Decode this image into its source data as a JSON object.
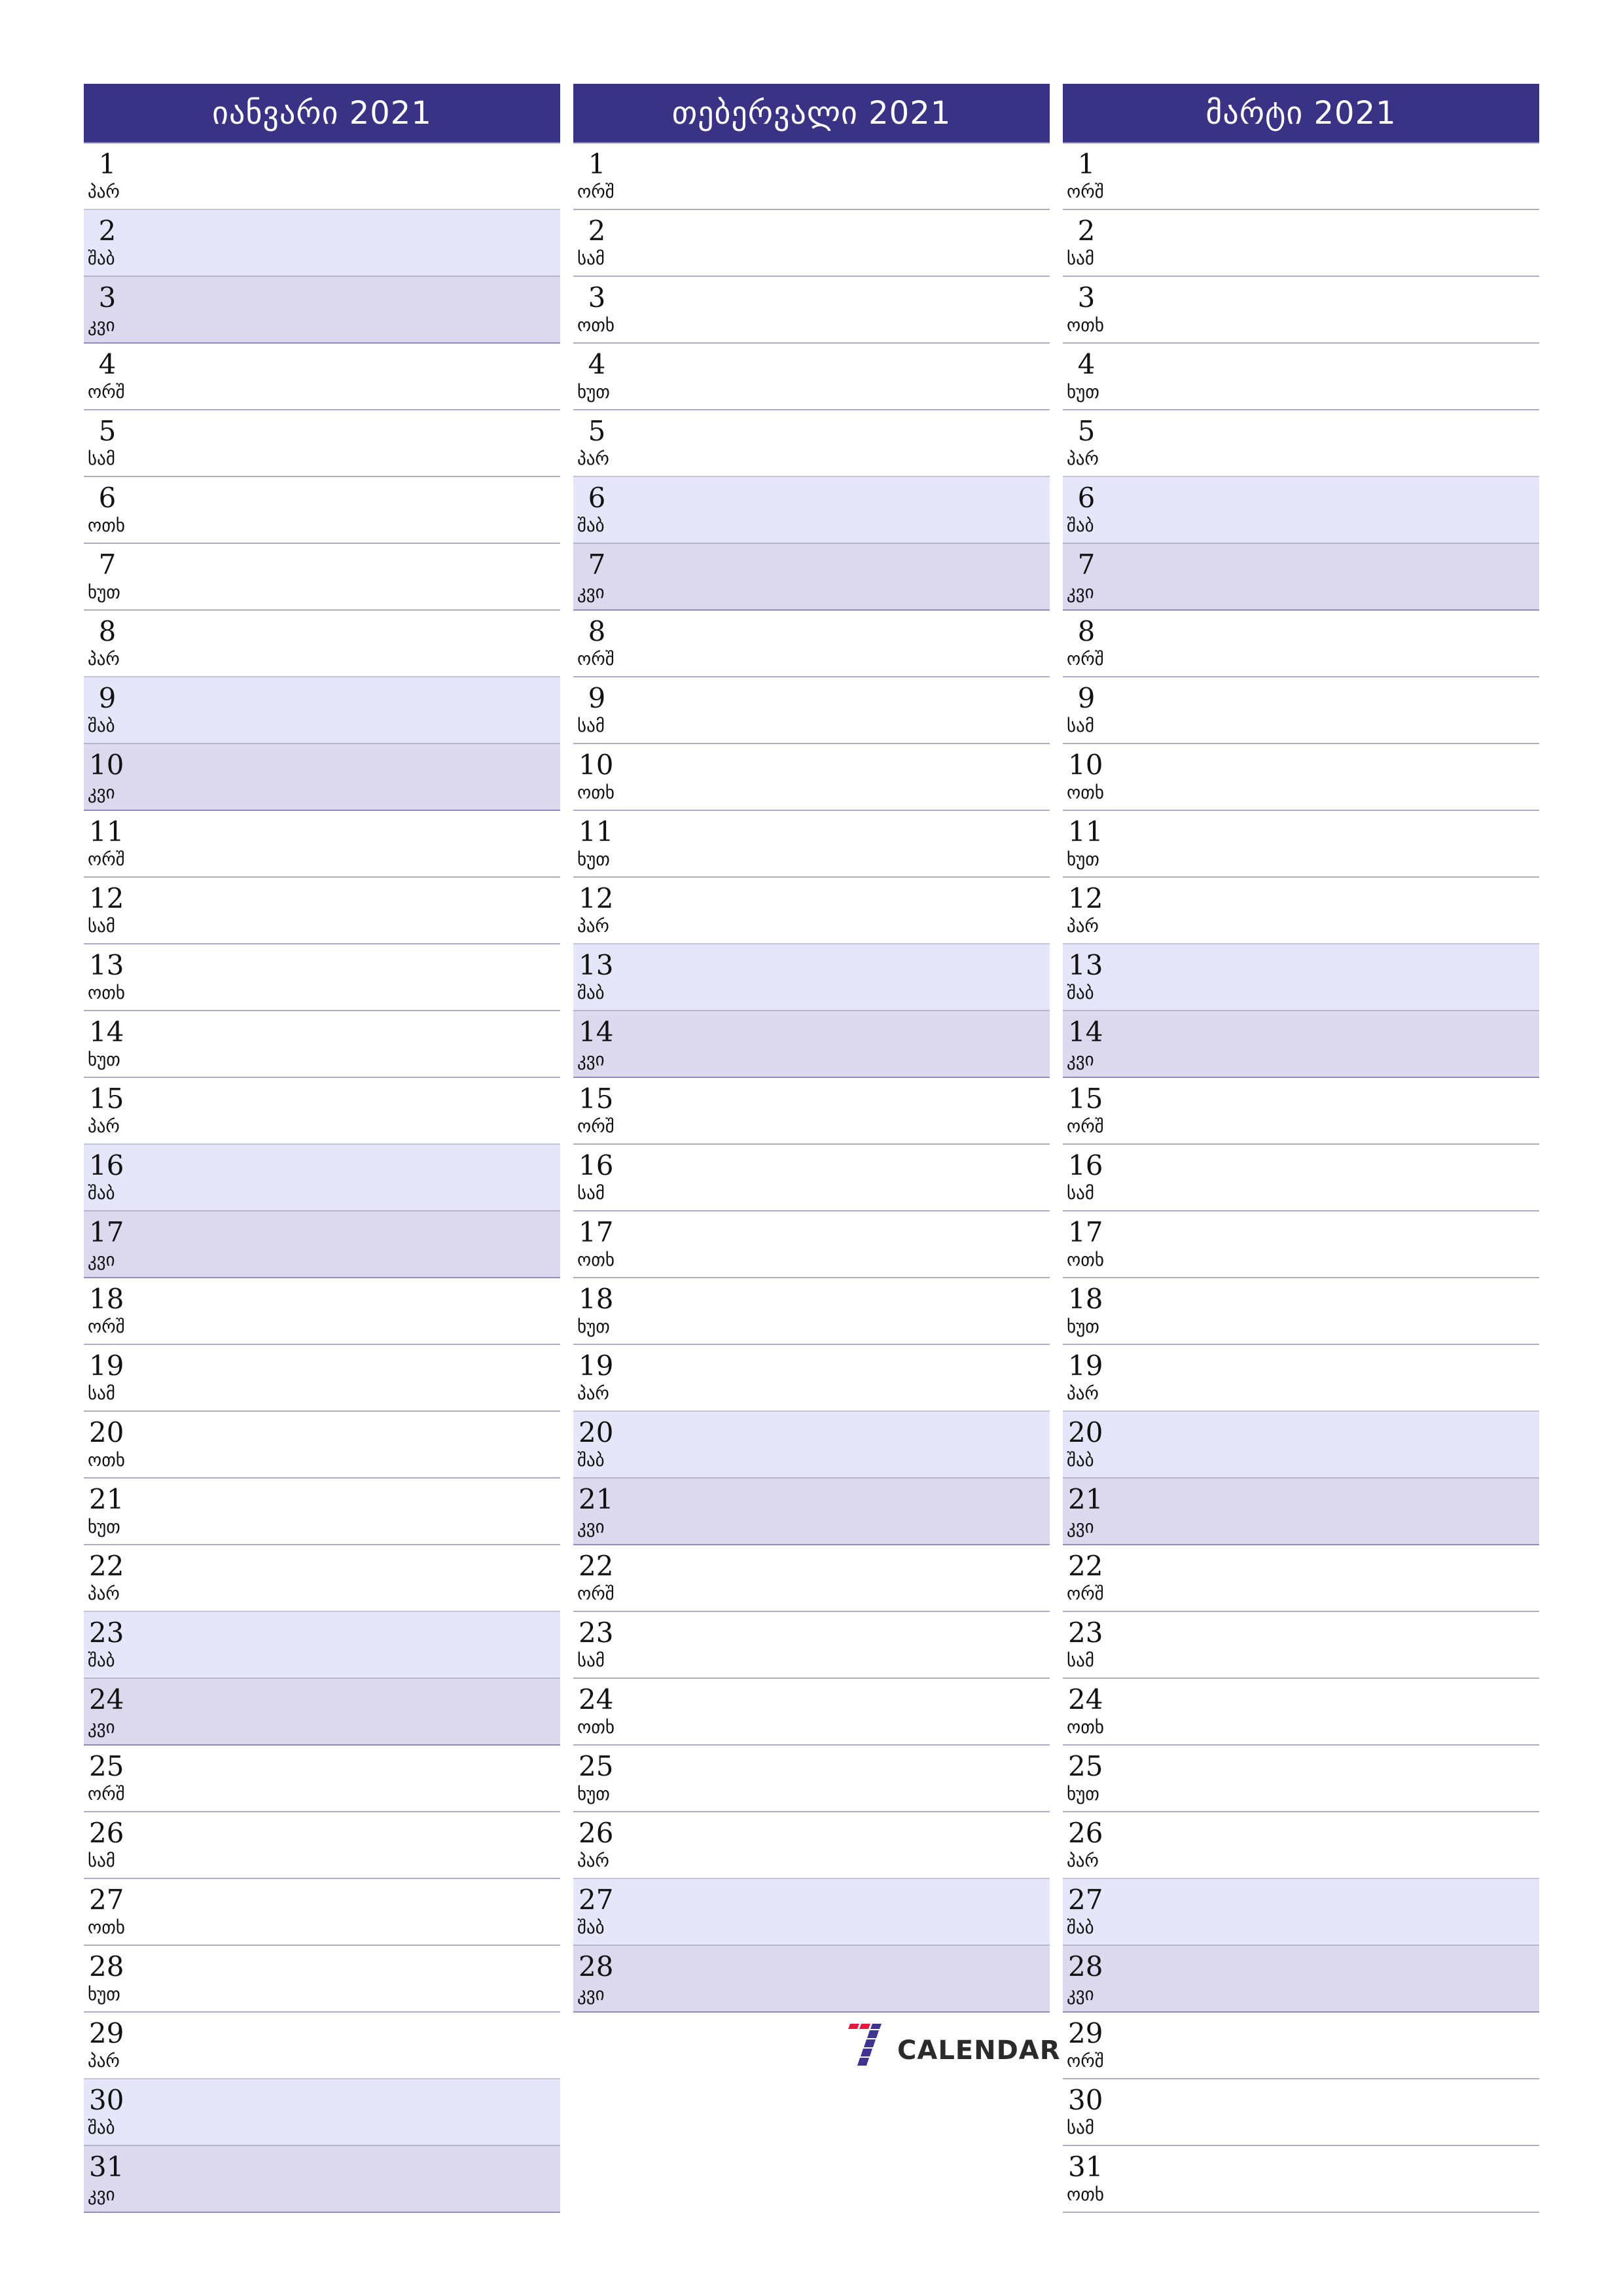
{
  "weekday_abbrev": {
    "mon": "ორშ",
    "tue": "სამ",
    "wed": "ოთხ",
    "thu": "ხუთ",
    "fri": "პარ",
    "sat": "შაბ",
    "sun": "კვი"
  },
  "colors": {
    "header_bg": "#3a3385",
    "saturday_bg": "#e5e6f9",
    "sunday_bg": "#dcd8ee",
    "logo_red": "#e8173f",
    "logo_blue": "#3d3490"
  },
  "months": [
    {
      "title": "იანვარი 2021",
      "first_weekday": "fri",
      "days": 31
    },
    {
      "title": "თებერვალი 2021",
      "first_weekday": "mon",
      "days": 28
    },
    {
      "title": "მარტი 2021",
      "first_weekday": "mon",
      "days": 31
    }
  ],
  "logo": {
    "text": "CALENDAR",
    "icon": "seven-logo-icon"
  }
}
